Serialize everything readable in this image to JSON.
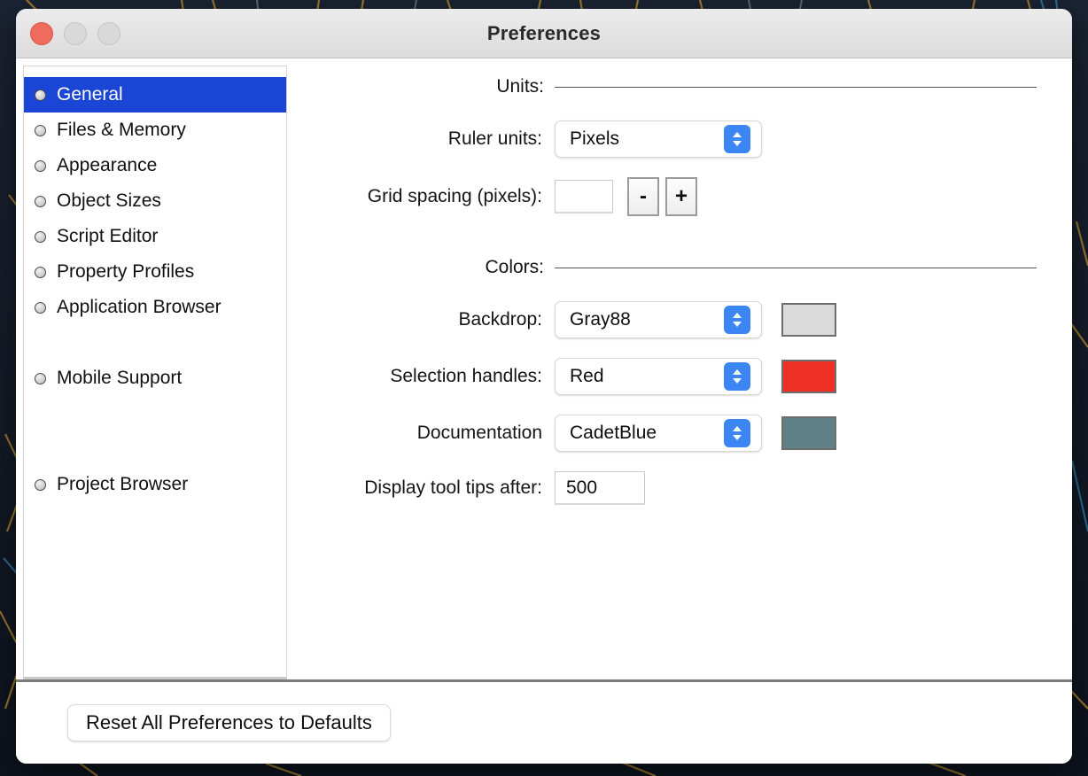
{
  "window": {
    "title": "Preferences",
    "controls": [
      {
        "name": "close",
        "color": "#ef6b5d"
      },
      {
        "name": "minimize",
        "color": "#d9d9d9"
      },
      {
        "name": "maximize",
        "color": "#d9d9d9"
      }
    ]
  },
  "sidebar": {
    "items": [
      {
        "label": "General",
        "selected": true
      },
      {
        "label": "Files & Memory",
        "selected": false
      },
      {
        "label": "Appearance",
        "selected": false
      },
      {
        "label": "Object Sizes",
        "selected": false
      },
      {
        "label": "Script Editor",
        "selected": false
      },
      {
        "label": "Property Profiles",
        "selected": false
      },
      {
        "label": "Application Browser",
        "selected": false
      },
      {
        "label": "Mobile Support",
        "selected": false
      },
      {
        "label": "Project Browser",
        "selected": false
      }
    ],
    "selection_color": "#1B45D4"
  },
  "main": {
    "sections": {
      "units_label": "Units:",
      "colors_label": "Colors:"
    },
    "ruler_units": {
      "label": "Ruler units:",
      "value": "Pixels"
    },
    "grid_spacing": {
      "label": "Grid spacing (pixels):",
      "value": "",
      "placeholder": "",
      "minus_label": "-",
      "plus_label": "+"
    },
    "backdrop": {
      "label": "Backdrop:",
      "value": "Gray88",
      "swatch": "#DBDBDB"
    },
    "selection_handles": {
      "label": "Selection handles:",
      "value": "Red",
      "swatch": "#EE3124"
    },
    "documentation": {
      "label": "Documentation",
      "value": "CadetBlue",
      "swatch": "#5F8187"
    },
    "tooltip_delay": {
      "label": "Display tool tips after:",
      "value": "500"
    }
  },
  "footer": {
    "reset_label": "Reset All Preferences to Defaults"
  }
}
